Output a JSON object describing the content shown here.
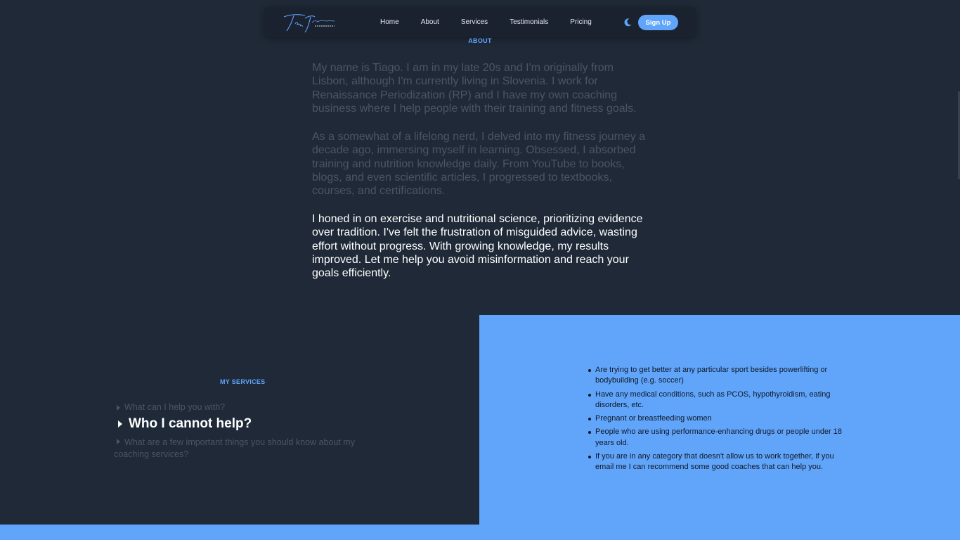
{
  "nav": {
    "logo_alt": "Tiago Fitness Coaching",
    "links": [
      "Home",
      "About",
      "Services",
      "Testimonials",
      "Pricing"
    ],
    "theme_icon": "moon-icon",
    "signup_label": "Sign Up"
  },
  "about": {
    "label": "ABOUT",
    "paragraphs": [
      "My name is Tiago. I am in my late 20s and I'm originally from Lisbon, although I'm currently living in Slovenia. I work for Renaissance Periodization (RP) and I have my own coaching business where I help people with their training and fitness goals.",
      "As a somewhat of a lifelong nerd, I delved into my fitness journey a decade ago, immersing myself in learning. Obsessed, I absorbed training and nutrition knowledge daily. From YouTube to books, blogs, and even scientific articles, I progressed to textbooks, courses, and certifications.",
      "I honed in on exercise and nutritional science, prioritizing evidence over tradition. I've felt the frustration of misguided advice, wasting effort without progress. With growing knowledge, my results improved. Let me help you avoid misinformation and reach your goals efficiently."
    ]
  },
  "services": {
    "label": "MY SERVICES",
    "faq": [
      "What can I help you with?",
      "Who I cannot help?",
      "What are a few important things you should know about my coaching services?"
    ],
    "cannot_help": [
      "Are trying to get better at any particular sport besides powerlifting or bodybuilding (e.g. soccer)",
      "Have any medical conditions, such as PCOS, hypothyroidism, eating disorders, etc.",
      "Pregnant or breastfeeding women",
      "People who are using performance-enhancing drugs or people under 18 years old.",
      "If you are in any category that doesn't allow us to work together, if you email me I can recommend some good coaches that can help you."
    ]
  },
  "colors": {
    "background": "#1f2937",
    "accent": "#60a5fa",
    "muted_text": "#4b5563"
  }
}
